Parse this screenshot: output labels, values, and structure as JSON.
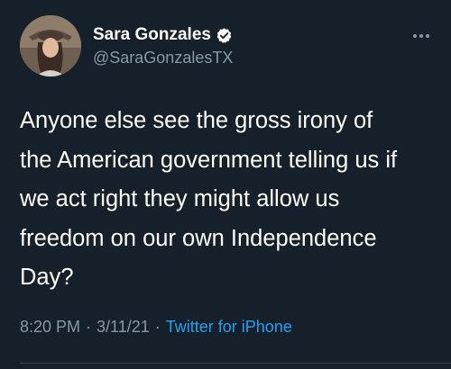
{
  "tweet": {
    "author": {
      "display_name": "Sara Gonzales",
      "handle": "@SaraGonzalesTX",
      "verified": true
    },
    "text": "Anyone else see the gross irony of\nthe American government telling us if\nwe act right they might allow us\nfreedom on our own Independence\nDay?",
    "time": "8:20 PM",
    "separator": "·",
    "date": "3/11/21",
    "source": "Twitter for iPhone"
  },
  "icons": {
    "verified": "verified-badge-icon",
    "more": "more-options-icon"
  },
  "colors": {
    "background": "#15202b",
    "primary_text": "#ffffff",
    "secondary_text": "#8899a6",
    "accent": "#1da1f2",
    "divider": "#38444d"
  }
}
